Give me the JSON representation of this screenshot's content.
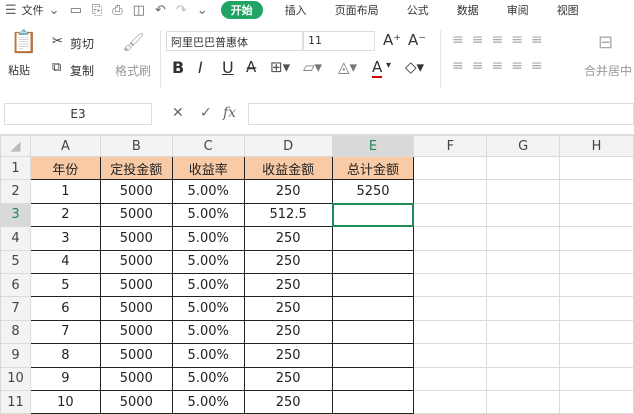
{
  "menu": {
    "file": "文件",
    "tabs": [
      "开始",
      "插入",
      "页面布局",
      "公式",
      "数据",
      "审阅",
      "视图"
    ],
    "active_tab": "开始"
  },
  "ribbon": {
    "paste": "粘贴",
    "cut": "剪切",
    "copy": "复制",
    "format_painter": "格式刷",
    "font_name": "阿里巴巴普惠体",
    "font_size": "11",
    "merge": "合并居中",
    "bold": "B",
    "italic": "I",
    "underline": "U"
  },
  "formula_bar": {
    "cell_ref": "E3",
    "fx": "fx",
    "value": ""
  },
  "columns": [
    "A",
    "B",
    "C",
    "D",
    "E",
    "F",
    "G",
    "H"
  ],
  "selected_cell": "E3",
  "rows": [
    [
      "年份",
      "定投金额",
      "收益率",
      "收益金额",
      "总计金额"
    ],
    [
      "1",
      "5000",
      "5.00%",
      "250",
      "5250"
    ],
    [
      "2",
      "5000",
      "5.00%",
      "512.5",
      ""
    ],
    [
      "3",
      "5000",
      "5.00%",
      "250",
      ""
    ],
    [
      "4",
      "5000",
      "5.00%",
      "250",
      ""
    ],
    [
      "5",
      "5000",
      "5.00%",
      "250",
      ""
    ],
    [
      "6",
      "5000",
      "5.00%",
      "250",
      ""
    ],
    [
      "7",
      "5000",
      "5.00%",
      "250",
      ""
    ],
    [
      "8",
      "5000",
      "5.00%",
      "250",
      ""
    ],
    [
      "9",
      "5000",
      "5.00%",
      "250",
      ""
    ],
    [
      "10",
      "5000",
      "5.00%",
      "250",
      ""
    ]
  ],
  "colors": {
    "accent": "#1fa463",
    "header_fill": "#f8cba6",
    "selection": "#1d8a57"
  }
}
